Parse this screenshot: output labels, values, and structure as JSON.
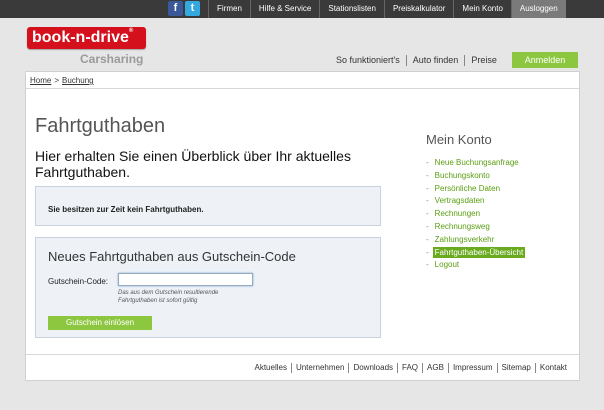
{
  "topbar": {
    "social": [
      {
        "icon": "facebook-icon",
        "glyph": "f"
      },
      {
        "icon": "twitter-icon",
        "glyph": "t"
      }
    ],
    "nav": [
      {
        "label": "Firmen"
      },
      {
        "label": "Hilfe & Service"
      },
      {
        "label": "Stationslisten"
      },
      {
        "label": "Preiskalkulator"
      },
      {
        "label": "Mein Konto"
      },
      {
        "label": "Ausloggen"
      }
    ]
  },
  "header": {
    "logo": "book-n-drive",
    "logo_mark": "®",
    "logo_sub": "Carsharing",
    "nav": [
      {
        "label": "So funktioniert's"
      },
      {
        "label": "Auto finden"
      },
      {
        "label": "Preise"
      }
    ],
    "login_label": "Anmelden"
  },
  "breadcrumb": {
    "home": "Home",
    "separator": ">",
    "current": "Buchung"
  },
  "main": {
    "title": "Fahrtguthaben",
    "intro": "Hier erhalten Sie einen Überblick über Ihr aktuelles Fahrtguthaben.",
    "info_text": "Sie besitzen zur Zeit kein Fahrtguthaben.",
    "voucher": {
      "heading": "Neues Fahrtguthaben aus Gutschein-Code",
      "label": "Gutschein-Code:",
      "value": "",
      "hint": "Das aus dem Gutschein resultierende Fahrtguthaben ist sofort gültig",
      "button": "Gutschein einlösen"
    }
  },
  "sidebar": {
    "title": "Mein Konto",
    "dash": "-",
    "items": [
      {
        "label": "Neue Buchungsanfrage"
      },
      {
        "label": "Buchungskonto"
      },
      {
        "label": "Persönliche Daten"
      },
      {
        "label": "Vertragsdaten"
      },
      {
        "label": "Rechnungen"
      },
      {
        "label": "Rechnungsweg"
      },
      {
        "label": "Zahlungsverkehr"
      },
      {
        "label": "Fahrtguthaben-Übersicht"
      },
      {
        "label": "Logout"
      }
    ]
  },
  "footer": {
    "links": [
      {
        "label": "Aktuelles"
      },
      {
        "label": "Unternehmen"
      },
      {
        "label": "Downloads"
      },
      {
        "label": "FAQ"
      },
      {
        "label": "AGB"
      },
      {
        "label": "Impressum"
      },
      {
        "label": "Sitemap"
      },
      {
        "label": "Kontakt"
      }
    ]
  },
  "colors": {
    "brand_red": "#d3101c",
    "accent_green": "#8dc63f",
    "link_green": "#5a9e12",
    "topbar": "#3a3a3a"
  }
}
